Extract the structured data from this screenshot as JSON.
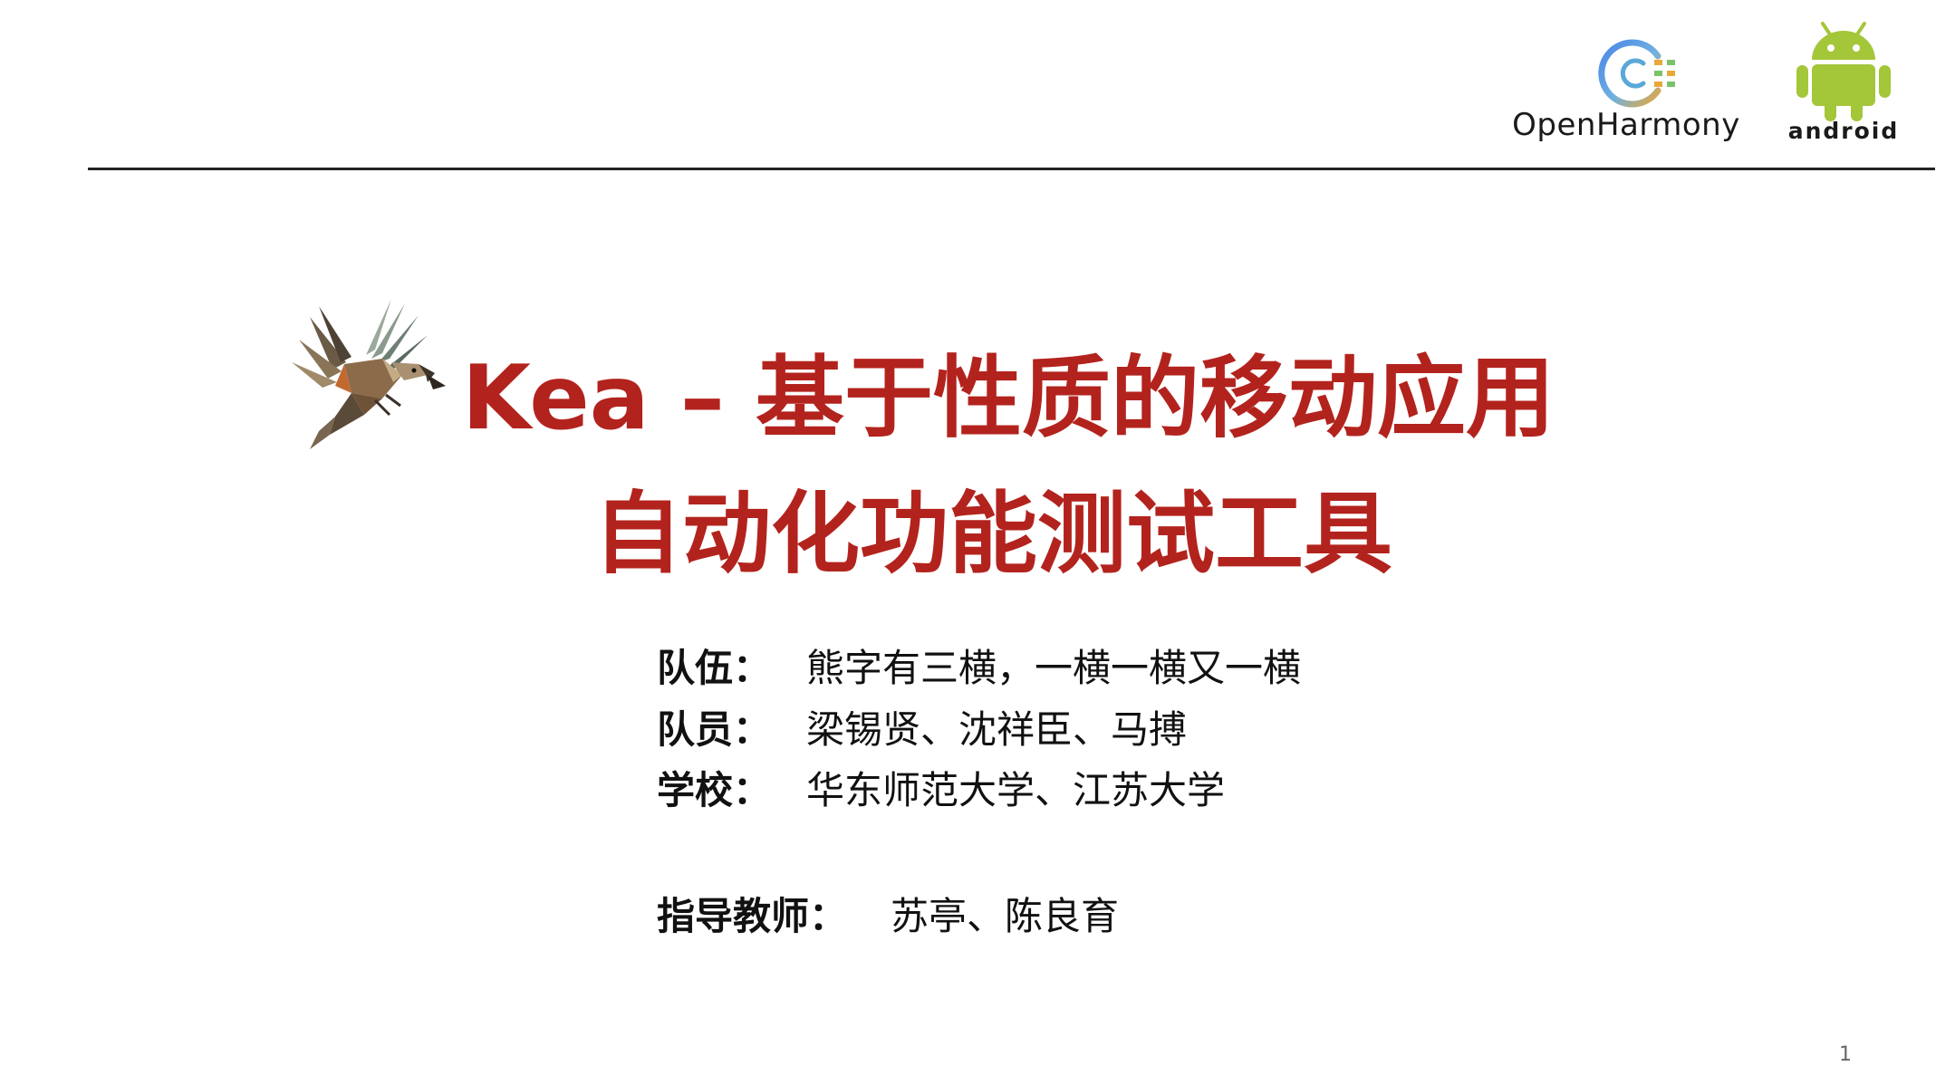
{
  "logos": {
    "openharmony": {
      "name": "OpenHarmony",
      "colors": [
        "#4a86e8",
        "#e8a93b",
        "#7ac36a"
      ]
    },
    "android": {
      "name": "ANDROID",
      "color": "#a4c639"
    },
    "bird_logo": {
      "icon": "kea-bird-icon"
    }
  },
  "title": {
    "line1": "Kea – 基于性质的移动应用",
    "line2": "自动化功能测试工具",
    "color": "#b3231d"
  },
  "info": {
    "team": {
      "label": "队伍：",
      "value": "熊字有三横，一横一横又一横"
    },
    "members": {
      "label": "队员：",
      "value": "梁锡贤、沈祥臣、马搏"
    },
    "school": {
      "label": "学校：",
      "value": "华东师范大学、江苏大学"
    },
    "advisor": {
      "label": "指导教师：",
      "value": "苏亭、陈良育"
    }
  },
  "page_number": "1"
}
